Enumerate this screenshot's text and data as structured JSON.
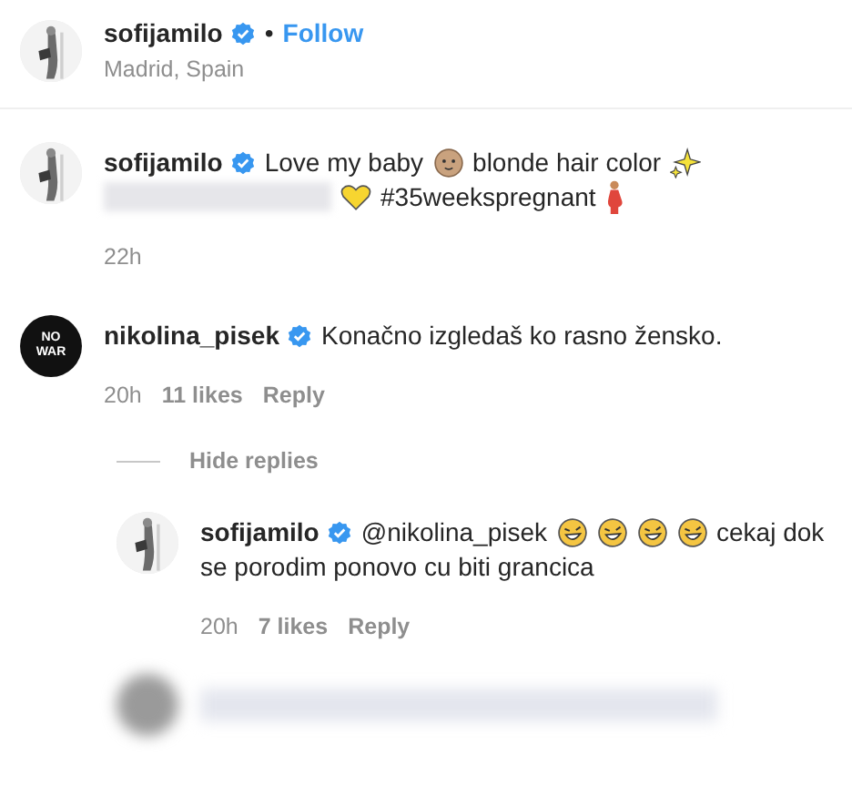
{
  "post_header": {
    "username": "sofijamilo",
    "verified": true,
    "separator": "•",
    "follow": "Follow",
    "location": "Madrid, Spain"
  },
  "comments": [
    {
      "avatar": {
        "kind": "picture"
      },
      "username": "sofijamilo",
      "verified": true,
      "lines": [
        [
          {
            "kind": "text",
            "text": "Love my baby"
          },
          {
            "kind": "baby"
          },
          {
            "kind": "text",
            "text": "blonde hair color"
          },
          {
            "kind": "sparkles"
          }
        ],
        [
          {
            "kind": "blur"
          },
          {
            "kind": "heart"
          },
          {
            "kind": "text",
            "text": "#35weekspregnant"
          },
          {
            "kind": "pregnant"
          }
        ]
      ],
      "time": "22h"
    },
    {
      "avatar": {
        "kind": "badge",
        "text": [
          "NO",
          "WAR"
        ]
      },
      "username": "nikolina_pisek",
      "verified": true,
      "lines": [
        [
          {
            "kind": "text",
            "text": "Konačno izgledaš ko rasno žensko."
          }
        ]
      ],
      "time": "20h",
      "likes": "11 likes",
      "reply": "Reply",
      "hide_replies": "Hide replies",
      "replies": [
        {
          "avatar": {
            "kind": "picture"
          },
          "username": "sofijamilo",
          "verified": true,
          "lines": [
            [
              {
                "kind": "text",
                "text": "@nikolina_pisek"
              },
              {
                "kind": "laugh"
              },
              {
                "kind": "laugh"
              },
              {
                "kind": "laugh"
              },
              {
                "kind": "laugh"
              },
              {
                "kind": "text",
                "text": "cekaj dok"
              }
            ],
            [
              {
                "kind": "text",
                "text": "se porodim ponovo cu biti grancica"
              }
            ]
          ],
          "time": "20h",
          "likes": "7 likes",
          "reply": "Reply"
        }
      ]
    }
  ]
}
